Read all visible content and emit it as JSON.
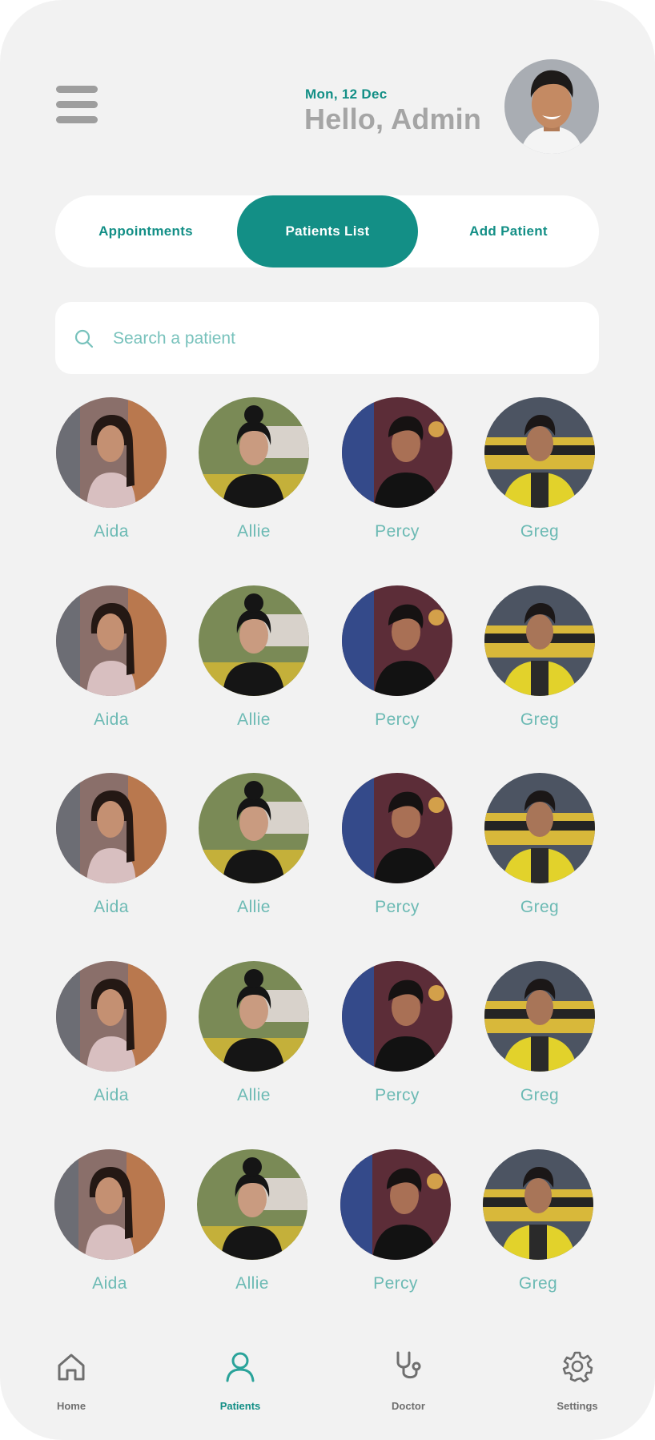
{
  "header": {
    "date": "Mon, 12 Dec",
    "greeting": "Hello, Admin"
  },
  "tabs": [
    {
      "label": "Appointments",
      "active": false
    },
    {
      "label": "Patients List",
      "active": true
    },
    {
      "label": "Add Patient",
      "active": false
    }
  ],
  "search": {
    "placeholder": "Search a patient",
    "value": ""
  },
  "patients": [
    {
      "name": "Aida"
    },
    {
      "name": "Allie"
    },
    {
      "name": "Percy"
    },
    {
      "name": "Greg"
    },
    {
      "name": "Aida"
    },
    {
      "name": "Allie"
    },
    {
      "name": "Percy"
    },
    {
      "name": "Greg"
    },
    {
      "name": "Aida"
    },
    {
      "name": "Allie"
    },
    {
      "name": "Percy"
    },
    {
      "name": "Greg"
    },
    {
      "name": "Aida"
    },
    {
      "name": "Allie"
    },
    {
      "name": "Percy"
    },
    {
      "name": "Greg"
    },
    {
      "name": "Aida"
    },
    {
      "name": "Allie"
    },
    {
      "name": "Percy"
    },
    {
      "name": "Greg"
    }
  ],
  "bottom_nav": [
    {
      "label": "Home",
      "icon": "home-icon",
      "active": false
    },
    {
      "label": "Patients",
      "icon": "user-icon",
      "active": true
    },
    {
      "label": "Doctor",
      "icon": "stethoscope-icon",
      "active": false
    },
    {
      "label": "Settings",
      "icon": "gear-icon",
      "active": false
    }
  ],
  "colors": {
    "primary": "#138f86",
    "name_text": "#6cbab4",
    "greeting_text": "#a5a5a5",
    "background": "#f2f2f2"
  }
}
